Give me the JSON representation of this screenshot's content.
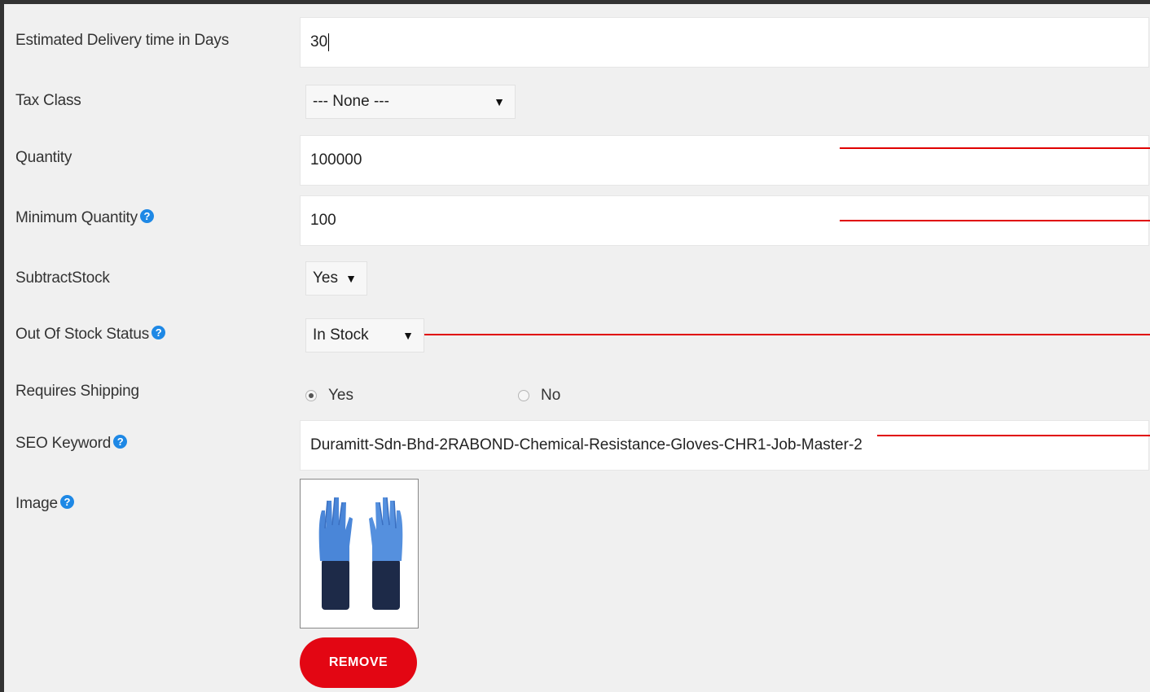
{
  "form": {
    "delivery": {
      "label": "Estimated Delivery time in Days",
      "value": "30"
    },
    "tax_class": {
      "label": "Tax Class",
      "value": "--- None ---"
    },
    "quantity": {
      "label": "Quantity",
      "value": "100000"
    },
    "minimum_quantity": {
      "label": "Minimum Quantity",
      "value": "100"
    },
    "subtract_stock": {
      "label": "SubtractStock",
      "value": "Yes"
    },
    "out_of_stock_status": {
      "label": "Out Of Stock Status",
      "value": "In Stock"
    },
    "requires_shipping": {
      "label": "Requires Shipping",
      "options": [
        "Yes",
        "No"
      ],
      "selected": "Yes"
    },
    "seo_keyword": {
      "label": "SEO Keyword",
      "value": "Duramitt-Sdn-Bhd-2RABOND-Chemical-Resistance-Gloves-CHR1-Job-Master-2"
    },
    "image": {
      "label": "Image",
      "remove_label": "REMOVE"
    }
  },
  "icons": {
    "help": "question-circle-icon",
    "dropdown": "caret-down-icon",
    "help_glyph": "?",
    "arrow_glyph": "▼"
  },
  "colors": {
    "accent_red": "#e30613",
    "annotation_red": "#e00000",
    "help_blue": "#1e88e5",
    "glove_blue": "#4a86d8",
    "glove_navy": "#1d2a48"
  }
}
